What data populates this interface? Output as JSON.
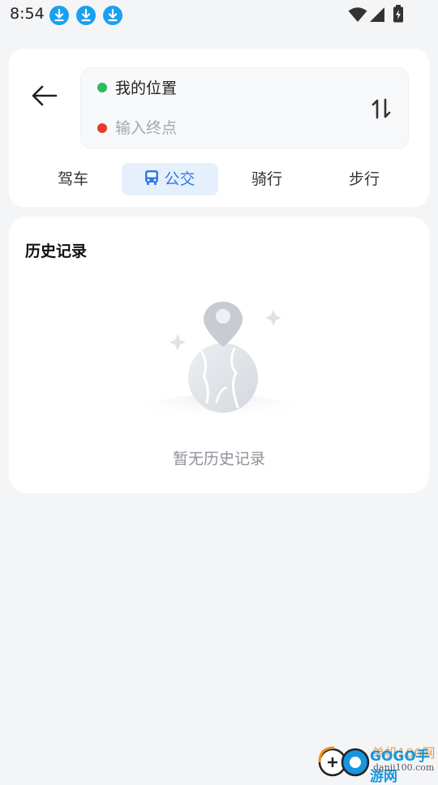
{
  "status_bar": {
    "time": "8:54",
    "icons": [
      "download-icon",
      "download-icon",
      "download-icon",
      "wifi-icon",
      "signal-icon",
      "battery-icon"
    ]
  },
  "route": {
    "start_label": "我的位置",
    "end_placeholder": "输入终点",
    "start_dot_color": "#2fba5b",
    "end_dot_color": "#e93a30"
  },
  "modes": {
    "tabs": [
      {
        "label": "驾车"
      },
      {
        "label": "公交"
      },
      {
        "label": "骑行"
      },
      {
        "label": "步行"
      }
    ],
    "active": "公交",
    "accent_color": "#2f7be8"
  },
  "history": {
    "title": "历史记录",
    "empty_text": "暂无历史记录"
  },
  "watermark": {
    "brand": "GOGO手游网",
    "site": "单机100网",
    "url": "danji100.com"
  }
}
